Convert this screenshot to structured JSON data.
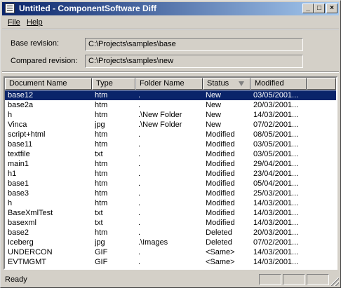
{
  "window": {
    "title": "Untitled - ComponentSoftware Diff",
    "buttons": {
      "minimize": "_",
      "maximize": "□",
      "close": "×"
    }
  },
  "menu": {
    "file": "File",
    "help": "Help"
  },
  "base_revision": {
    "label": "Base revision:",
    "value": "C:\\Projects\\samples\\base"
  },
  "compared_revision": {
    "label": "Compared revision:",
    "value": "C:\\Projects\\samples\\new"
  },
  "list": {
    "columns": {
      "name": "Document Name",
      "type": "Type",
      "folder": "Folder Name",
      "status": "Status",
      "modified": "Modified"
    },
    "selected_index": 0,
    "rows": [
      {
        "name": "base12",
        "type": "htm",
        "folder": ".",
        "status": "New",
        "modified": "03/05/2001..."
      },
      {
        "name": "base2a",
        "type": "htm",
        "folder": ".",
        "status": "New",
        "modified": "20/03/2001..."
      },
      {
        "name": "h",
        "type": "htm",
        "folder": ".\\New Folder",
        "status": "New",
        "modified": "14/03/2001..."
      },
      {
        "name": "Vinca",
        "type": "jpg",
        "folder": ".\\New Folder",
        "status": "New",
        "modified": "07/02/2001..."
      },
      {
        "name": "script+html",
        "type": "htm",
        "folder": ".",
        "status": "Modified",
        "modified": "08/05/2001..."
      },
      {
        "name": "base11",
        "type": "htm",
        "folder": ".",
        "status": "Modified",
        "modified": "03/05/2001..."
      },
      {
        "name": "textfile",
        "type": "txt",
        "folder": ".",
        "status": "Modified",
        "modified": "03/05/2001..."
      },
      {
        "name": "main1",
        "type": "htm",
        "folder": ".",
        "status": "Modified",
        "modified": "29/04/2001..."
      },
      {
        "name": "h1",
        "type": "htm",
        "folder": ".",
        "status": "Modified",
        "modified": "23/04/2001..."
      },
      {
        "name": "base1",
        "type": "htm",
        "folder": ".",
        "status": "Modified",
        "modified": "05/04/2001..."
      },
      {
        "name": "base3",
        "type": "htm",
        "folder": ".",
        "status": "Modified",
        "modified": "25/03/2001..."
      },
      {
        "name": "h",
        "type": "htm",
        "folder": ".",
        "status": "Modified",
        "modified": "14/03/2001..."
      },
      {
        "name": "BaseXmlTest",
        "type": "txt",
        "folder": ".",
        "status": "Modified",
        "modified": "14/03/2001..."
      },
      {
        "name": "basexml",
        "type": "txt",
        "folder": ".",
        "status": "Modified",
        "modified": "14/03/2001..."
      },
      {
        "name": "base2",
        "type": "htm",
        "folder": ".",
        "status": "Deleted",
        "modified": "20/03/2001..."
      },
      {
        "name": "Iceberg",
        "type": "jpg",
        "folder": ".\\Images",
        "status": "Deleted",
        "modified": "07/02/2001..."
      },
      {
        "name": "UNDERCON",
        "type": "GIF",
        "folder": ".",
        "status": "<Same>",
        "modified": "14/03/2001..."
      },
      {
        "name": "EVTMGMT",
        "type": "GIF",
        "folder": ".",
        "status": "<Same>",
        "modified": "14/03/2001..."
      }
    ]
  },
  "statusbar": {
    "text": "Ready"
  }
}
